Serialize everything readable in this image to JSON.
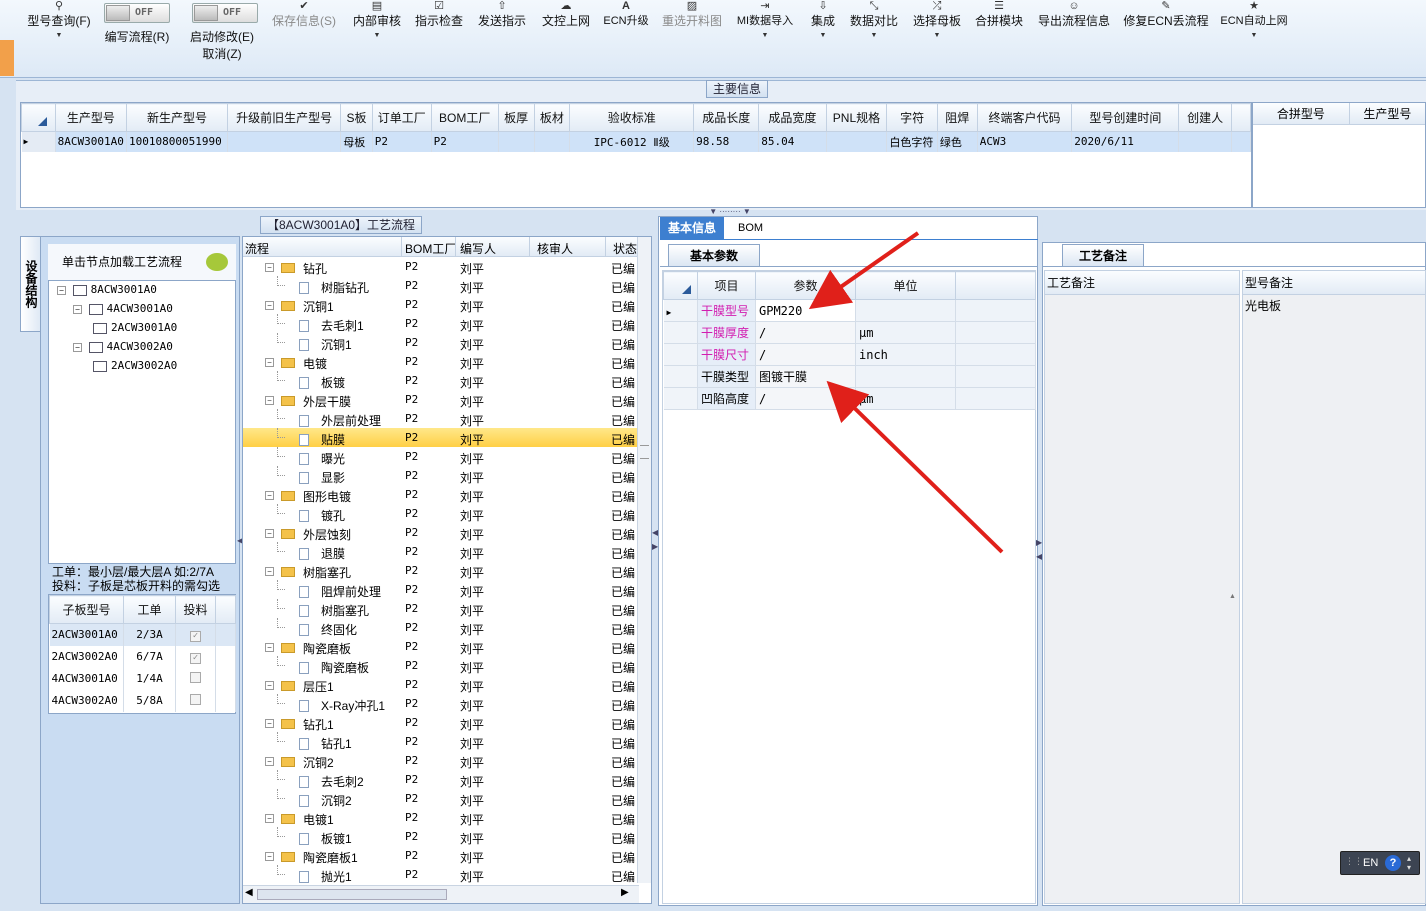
{
  "toolbar": {
    "items": [
      {
        "label": "型号查询(F)",
        "icon": "magnifier-icon"
      },
      {
        "label": "编写流程(R)",
        "icon": "toggle-switch"
      },
      {
        "label": "启动修改(E)",
        "icon": "toggle-switch"
      },
      {
        "label": "保存信息(S)",
        "icon": "checkmark-icon"
      },
      {
        "label": "内部审核",
        "icon": "printer-icon"
      },
      {
        "label": "指示检查",
        "icon": "checklist-icon"
      },
      {
        "label": "发送指示",
        "icon": "upload-icon"
      },
      {
        "label": "文控上网",
        "icon": "cloud-upload-icon"
      },
      {
        "label": "ECN升级",
        "icon": "letter-a-icon"
      },
      {
        "label": "重选开料图",
        "icon": "image-icon"
      },
      {
        "label": "MI数据导入",
        "icon": "import-icon"
      },
      {
        "label": "集成",
        "icon": "download-icon"
      },
      {
        "label": "数据对比",
        "icon": "compare-icon"
      },
      {
        "label": "选择母板",
        "icon": "shuffle-icon"
      },
      {
        "label": "合拼模块",
        "icon": "list-icon"
      },
      {
        "label": "导出流程信息",
        "icon": "smiley-icon"
      },
      {
        "label": "修复ECN丢流程",
        "icon": "wrench-icon"
      },
      {
        "label": "ECN自动上网",
        "icon": "star-icon"
      }
    ],
    "toggle_off": "OFF",
    "cancel_label": "取消(Z)"
  },
  "main_info": {
    "title": "主要信息",
    "columns": [
      "生产型号",
      "新生产型号",
      "升级前旧生产型号",
      "S板",
      "订单工厂",
      "BOM工厂",
      "板厚",
      "板材",
      "验收标准",
      "成品长度",
      "成品宽度",
      "PNL规格",
      "字符",
      "阻焊",
      "终端客户代码",
      "型号创建时间",
      "创建人"
    ],
    "row": [
      "8ACW3001A0",
      "10010800051990",
      "",
      "母板",
      "P2",
      "P2",
      "",
      "",
      "IPC-6012 Ⅱ级",
      "98.58",
      "85.04",
      "",
      "白色字符",
      "绿色",
      "ACW3",
      "2020/6/11",
      ""
    ],
    "right_columns": [
      "合拼型号",
      "生产型号"
    ]
  },
  "left_panel": {
    "vertical_tab": "设备结构",
    "hint": "单击节点加载工艺流程",
    "tree": [
      {
        "label": "8ACW3001A0",
        "level": 0
      },
      {
        "label": "4ACW3001A0",
        "level": 1
      },
      {
        "label": "2ACW3001A0",
        "level": 2
      },
      {
        "label": "4ACW3002A0",
        "level": 1
      },
      {
        "label": "2ACW3002A0",
        "level": 2
      }
    ],
    "note1": "工单：最小层/最大层A 如:2/7A",
    "note2": "投料：子板是芯板开料的需勾选",
    "sub_columns": [
      "子板型号",
      "工单",
      "投料"
    ],
    "sub_rows": [
      {
        "model": "2ACW3001A0",
        "order": "2/3A",
        "feed": true
      },
      {
        "model": "2ACW3002A0",
        "order": "6/7A",
        "feed": true
      },
      {
        "model": "4ACW3001A0",
        "order": "1/4A",
        "feed": false
      },
      {
        "model": "4ACW3002A0",
        "order": "5/8A",
        "feed": false
      }
    ]
  },
  "process": {
    "title": "【8ACW3001A0】工艺流程",
    "columns": [
      "流程",
      "BOM工厂",
      "编写人",
      "核审人",
      "状态"
    ],
    "rows": [
      {
        "name": "钻孔",
        "type": "folder",
        "bom": "P2",
        "writer": "刘平",
        "status": "已编"
      },
      {
        "name": "树脂钻孔",
        "type": "doc",
        "bom": "P2",
        "writer": "刘平",
        "status": "已编"
      },
      {
        "name": "沉铜1",
        "type": "folder",
        "bom": "P2",
        "writer": "刘平",
        "status": "已编"
      },
      {
        "name": "去毛刺1",
        "type": "doc",
        "bom": "P2",
        "writer": "刘平",
        "status": "已编"
      },
      {
        "name": "沉铜1",
        "type": "doc",
        "bom": "P2",
        "writer": "刘平",
        "status": "已编"
      },
      {
        "name": "电镀",
        "type": "folder",
        "bom": "P2",
        "writer": "刘平",
        "status": "已编"
      },
      {
        "name": "板镀",
        "type": "doc",
        "bom": "P2",
        "writer": "刘平",
        "status": "已编"
      },
      {
        "name": "外层干膜",
        "type": "folder",
        "bom": "P2",
        "writer": "刘平",
        "status": "已编"
      },
      {
        "name": "外层前处理",
        "type": "doc",
        "bom": "P2",
        "writer": "刘平",
        "status": "已编"
      },
      {
        "name": "贴膜",
        "type": "doc",
        "bom": "P2",
        "writer": "刘平",
        "status": "已编",
        "selected": true
      },
      {
        "name": "曝光",
        "type": "doc",
        "bom": "P2",
        "writer": "刘平",
        "status": "已编"
      },
      {
        "name": "显影",
        "type": "doc",
        "bom": "P2",
        "writer": "刘平",
        "status": "已编"
      },
      {
        "name": "图形电镀",
        "type": "folder",
        "bom": "P2",
        "writer": "刘平",
        "status": "已编"
      },
      {
        "name": "镀孔",
        "type": "doc",
        "bom": "P2",
        "writer": "刘平",
        "status": "已编"
      },
      {
        "name": "外层蚀刻",
        "type": "folder",
        "bom": "P2",
        "writer": "刘平",
        "status": "已编"
      },
      {
        "name": "退膜",
        "type": "doc",
        "bom": "P2",
        "writer": "刘平",
        "status": "已编"
      },
      {
        "name": "树脂塞孔",
        "type": "folder",
        "bom": "P2",
        "writer": "刘平",
        "status": "已编"
      },
      {
        "name": "阻焊前处理",
        "type": "doc",
        "bom": "P2",
        "writer": "刘平",
        "status": "已编"
      },
      {
        "name": "树脂塞孔",
        "type": "doc",
        "bom": "P2",
        "writer": "刘平",
        "status": "已编"
      },
      {
        "name": "终固化",
        "type": "doc",
        "bom": "P2",
        "writer": "刘平",
        "status": "已编"
      },
      {
        "name": "陶瓷磨板",
        "type": "folder",
        "bom": "P2",
        "writer": "刘平",
        "status": "已编"
      },
      {
        "name": "陶瓷磨板",
        "type": "doc",
        "bom": "P2",
        "writer": "刘平",
        "status": "已编"
      },
      {
        "name": "层压1",
        "type": "folder",
        "bom": "P2",
        "writer": "刘平",
        "status": "已编"
      },
      {
        "name": "X-Ray冲孔1",
        "type": "doc",
        "bom": "P2",
        "writer": "刘平",
        "status": "已编"
      },
      {
        "name": "钻孔1",
        "type": "folder",
        "bom": "P2",
        "writer": "刘平",
        "status": "已编"
      },
      {
        "name": "钻孔1",
        "type": "doc",
        "bom": "P2",
        "writer": "刘平",
        "status": "已编"
      },
      {
        "name": "沉铜2",
        "type": "folder",
        "bom": "P2",
        "writer": "刘平",
        "status": "已编"
      },
      {
        "name": "去毛刺2",
        "type": "doc",
        "bom": "P2",
        "writer": "刘平",
        "status": "已编"
      },
      {
        "name": "沉铜2",
        "type": "doc",
        "bom": "P2",
        "writer": "刘平",
        "status": "已编"
      },
      {
        "name": "电镀1",
        "type": "folder",
        "bom": "P2",
        "writer": "刘平",
        "status": "已编"
      },
      {
        "name": "板镀1",
        "type": "doc",
        "bom": "P2",
        "writer": "刘平",
        "status": "已编"
      },
      {
        "name": "陶瓷磨板1",
        "type": "folder",
        "bom": "P2",
        "writer": "刘平",
        "status": "已编"
      },
      {
        "name": "抛光1",
        "type": "doc",
        "bom": "P2",
        "writer": "刘平",
        "status": "已编"
      }
    ]
  },
  "detail": {
    "tabs": [
      "基本信息",
      "BOM"
    ],
    "sub_tab": "基本参数",
    "columns": [
      "项目",
      "参数",
      "单位"
    ],
    "params": [
      {
        "item": "干膜型号",
        "value": "GPM220",
        "unit": "",
        "highlight": true
      },
      {
        "item": "干膜厚度",
        "value": "/",
        "unit": "μm",
        "highlight": true
      },
      {
        "item": "干膜尺寸",
        "value": "/",
        "unit": "inch",
        "highlight": true
      },
      {
        "item": "干膜类型",
        "value": "图镀干膜",
        "unit": "",
        "highlight": false
      },
      {
        "item": "凹陷高度",
        "value": "/",
        "unit": "μm",
        "highlight": false
      }
    ]
  },
  "remarks": {
    "tab": "工艺备注",
    "col1": "工艺备注",
    "col2": "型号备注",
    "model_remark": "光电板"
  },
  "ime": {
    "label": "EN",
    "help": "?"
  },
  "colors": {
    "accent": "#3d7fd0",
    "highlight_text": "#d21cb0",
    "arrow": "#e0201a",
    "selected_row": "#ffd24d"
  }
}
